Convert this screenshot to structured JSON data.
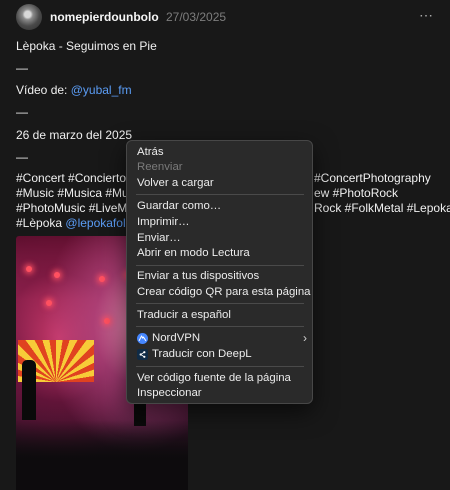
{
  "post": {
    "username": "nomepierdounbolo",
    "date": "27/03/2025",
    "more_label": "⋯",
    "lines": {
      "title": "Lèpoka - Seguimos en Pie",
      "dash1": "—",
      "video_prefix": "Vídeo de: ",
      "video_handle": "@yubal_fm",
      "dash2": "—",
      "date_text": "26 de marzo del 2025",
      "dash3": "—"
    },
    "hashtags": {
      "line1_left": "#Concert #Concierto #",
      "line1_right": "#ConcertPhotography",
      "line2_left": "#Music #Musica #Mus",
      "line2_right": "ew #PhotoRock",
      "line3_left": "#PhotoMusic #LiveMus",
      "line3_right": "Rock #FolkMetal #Lepoka",
      "line4_prefix": "#Lèpoka ",
      "line4_handle": "@lepokafolk"
    }
  },
  "context_menu": {
    "items": {
      "back": "Atrás",
      "forward": "Reenviar",
      "reload": "Volver a cargar",
      "save_as": "Guardar como…",
      "print": "Imprimir…",
      "send": "Enviar…",
      "reader_mode": "Abrir en modo Lectura",
      "send_to_devices": "Enviar a tus dispositivos",
      "qr_code": "Crear código QR para esta página",
      "translate": "Traducir a español",
      "nordvpn": "NordVPN",
      "deepl": "Traducir con DeepL",
      "view_source": "Ver código fuente de la página",
      "inspect": "Inspeccionar"
    },
    "submenu_chevron": "›"
  },
  "colors": {
    "background": "#181818",
    "link": "#5b9df6",
    "menu_background": "#2a2a2a",
    "disabled_text": "#7a7a7a"
  },
  "icons": {
    "nordvpn": "nordvpn-icon",
    "deepl": "deepl-icon"
  }
}
